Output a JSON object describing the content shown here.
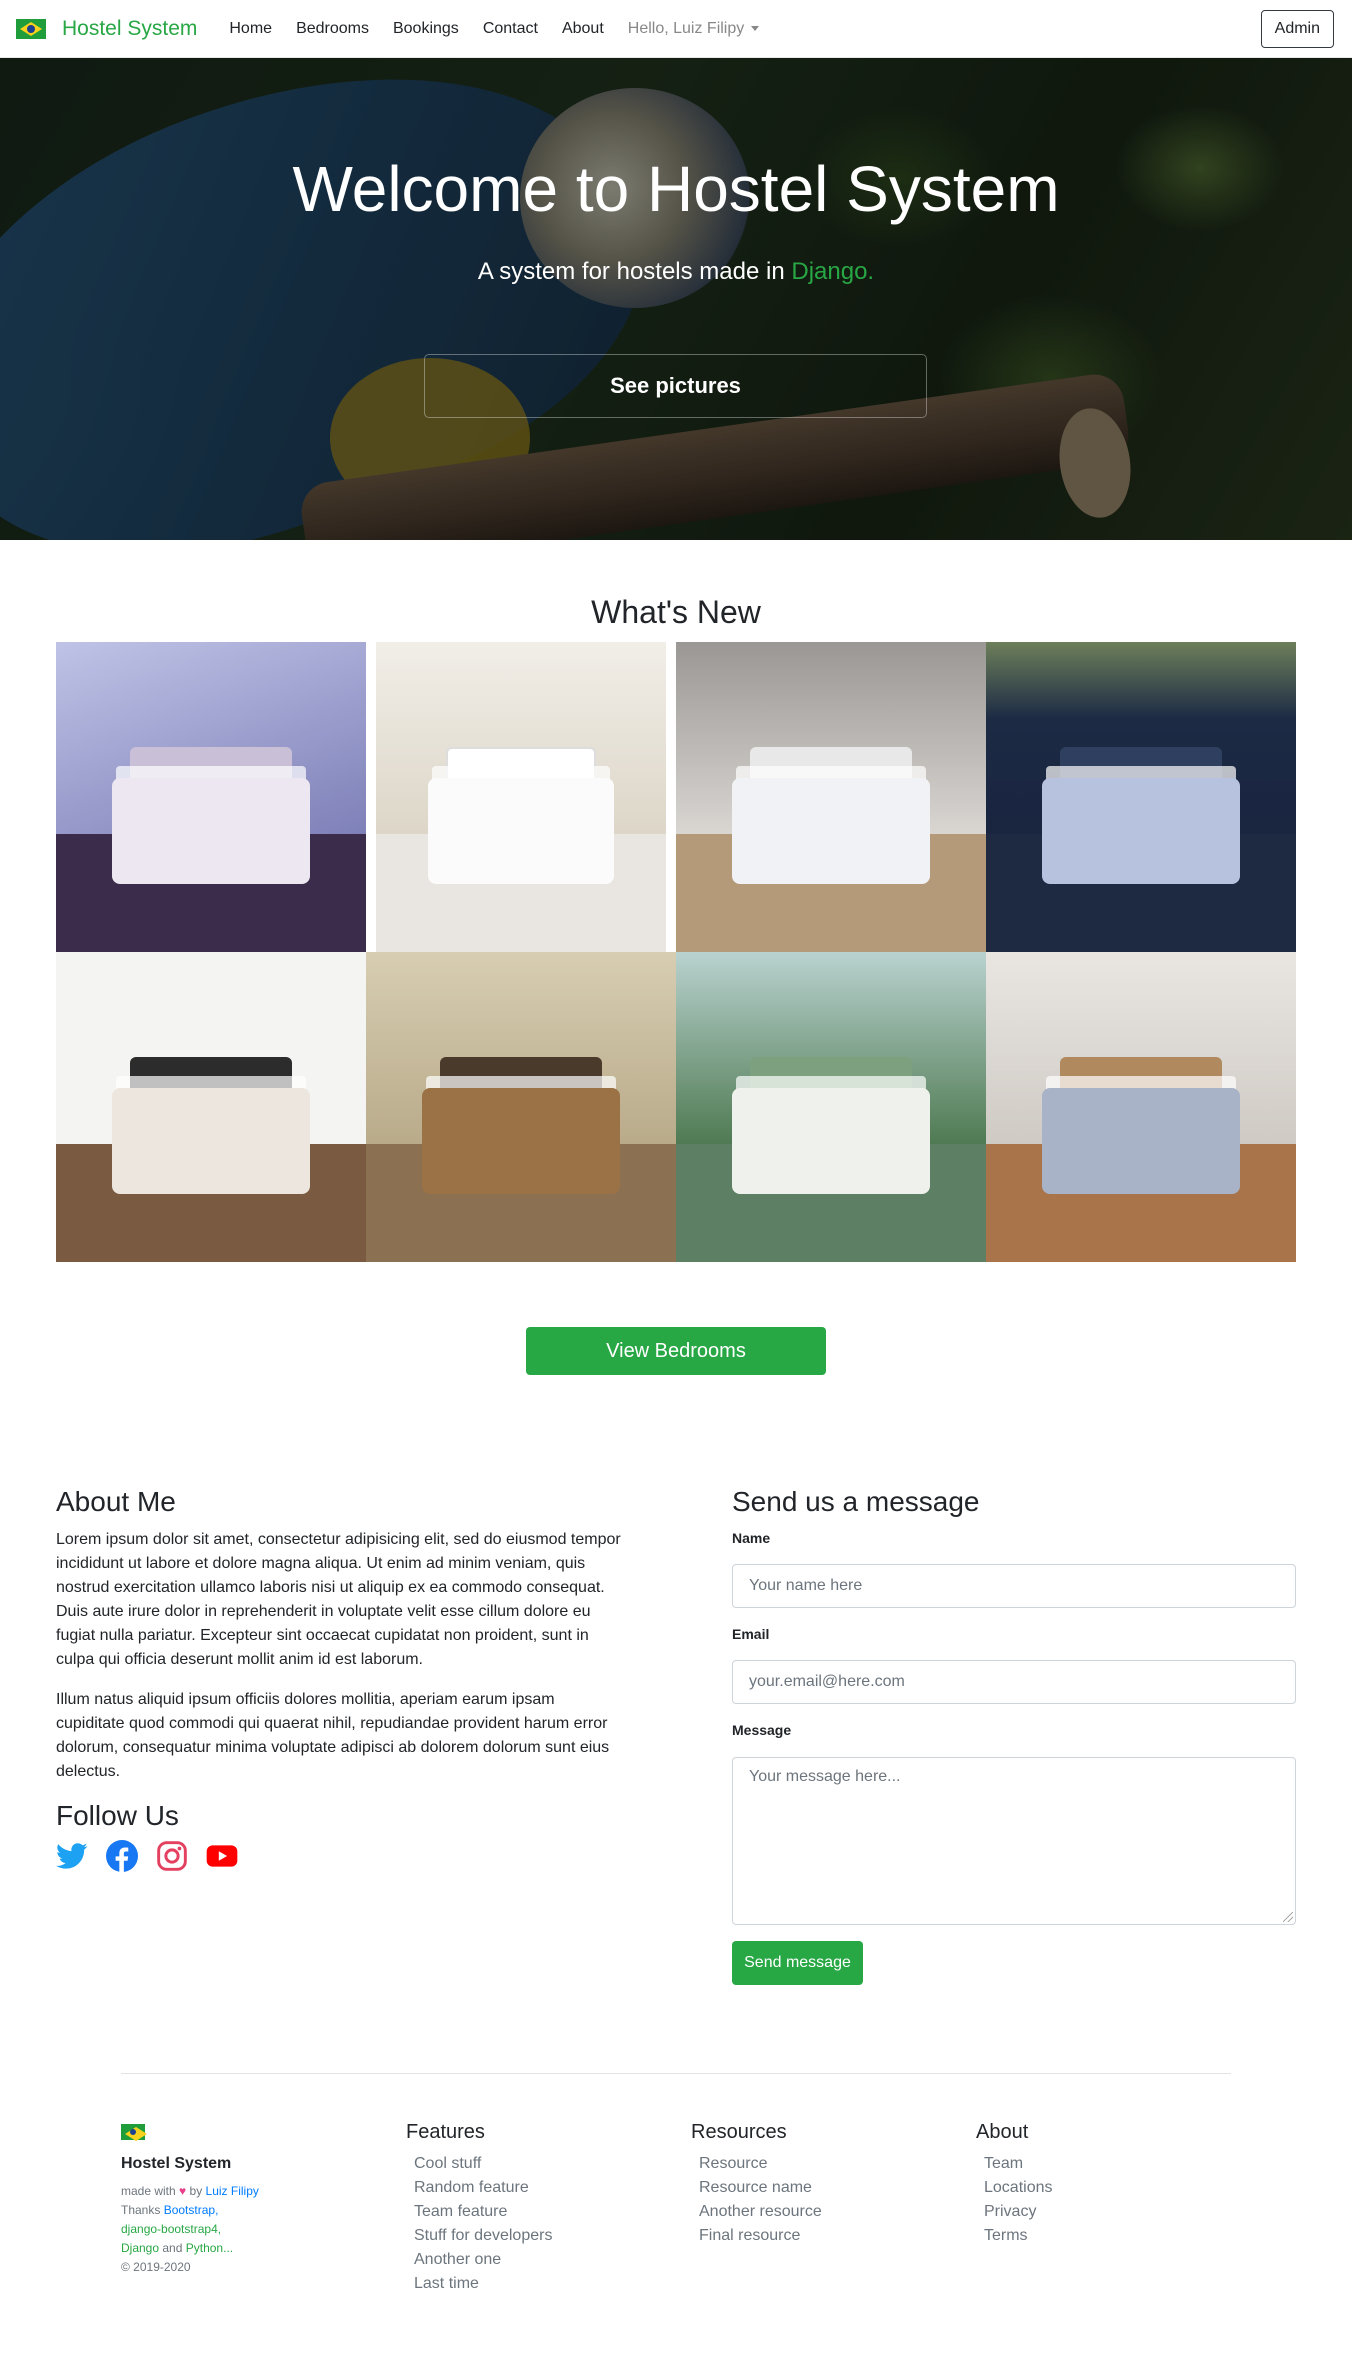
{
  "navbar": {
    "brand": "Hostel System",
    "links": [
      "Home",
      "Bedrooms",
      "Bookings",
      "Contact",
      "About"
    ],
    "user_menu": "Hello, Luiz Filipy",
    "admin_button": "Admin"
  },
  "hero": {
    "title": "Welcome to Hostel System",
    "subtitle_prefix": "A system for hostels made in ",
    "subtitle_accent": "Django.",
    "button": "See pictures"
  },
  "whats_new": {
    "title": "What's New",
    "button": "View Bedrooms"
  },
  "about": {
    "title": "About Me",
    "paragraphs": [
      "Lorem ipsum dolor sit amet, consectetur adipisicing elit, sed do eiusmod tempor incididunt ut labore et dolore magna aliqua. Ut enim ad minim veniam, quis nostrud exercitation ullamco laboris nisi ut aliquip ex ea commodo consequat. Duis aute irure dolor in reprehenderit in voluptate velit esse cillum dolore eu fugiat nulla pariatur. Excepteur sint occaecat cupidatat non proident, sunt in culpa qui officia deserunt mollit anim id est laborum.",
      "Illum natus aliquid ipsum officiis dolores mollitia, aperiam earum ipsam cupiditate quod commodi qui quaerat nihil, repudiandae provident harum error dolorum, consequatur minima voluptate adipisci ab dolorem dolorum sunt eius delectus."
    ],
    "follow_title": "Follow Us",
    "social_icons": [
      "twitter-icon",
      "facebook-icon",
      "instagram-icon",
      "youtube-icon"
    ],
    "social_colors": {
      "twitter": "#1da1f2",
      "facebook": "#1877f2",
      "instagram": "#e4405f",
      "youtube": "#ff0000"
    }
  },
  "contact": {
    "title": "Send us a message",
    "name_label": "Name",
    "name_placeholder": "Your name here",
    "email_label": "Email",
    "email_placeholder": "your.email@here.com",
    "message_label": "Message",
    "message_placeholder": "Your message here...",
    "submit": "Send message"
  },
  "footer": {
    "brand": "Hostel System",
    "made_with_prefix": "made with",
    "made_with_by": "by",
    "author": "Luiz Filipy",
    "thanks_prefix": "Thanks",
    "thanks_bootstrap": "Bootstrap,",
    "thanks_db4": "django-bootstrap4,",
    "thanks_django": "Django",
    "thanks_and": "and",
    "thanks_python": "Python...",
    "copyright": "© 2019-2020",
    "columns": [
      {
        "title": "Features",
        "links": [
          "Cool stuff",
          "Random feature",
          "Team feature",
          "Stuff for developers",
          "Another one",
          "Last time"
        ]
      },
      {
        "title": "Resources",
        "links": [
          "Resource",
          "Resource name",
          "Another resource",
          "Final resource"
        ]
      },
      {
        "title": "About",
        "links": [
          "Team",
          "Locations",
          "Privacy",
          "Terms"
        ]
      }
    ]
  },
  "colors": {
    "brand_green": "#28a745",
    "link_blue": "#007bff",
    "muted": "#6c757d"
  }
}
